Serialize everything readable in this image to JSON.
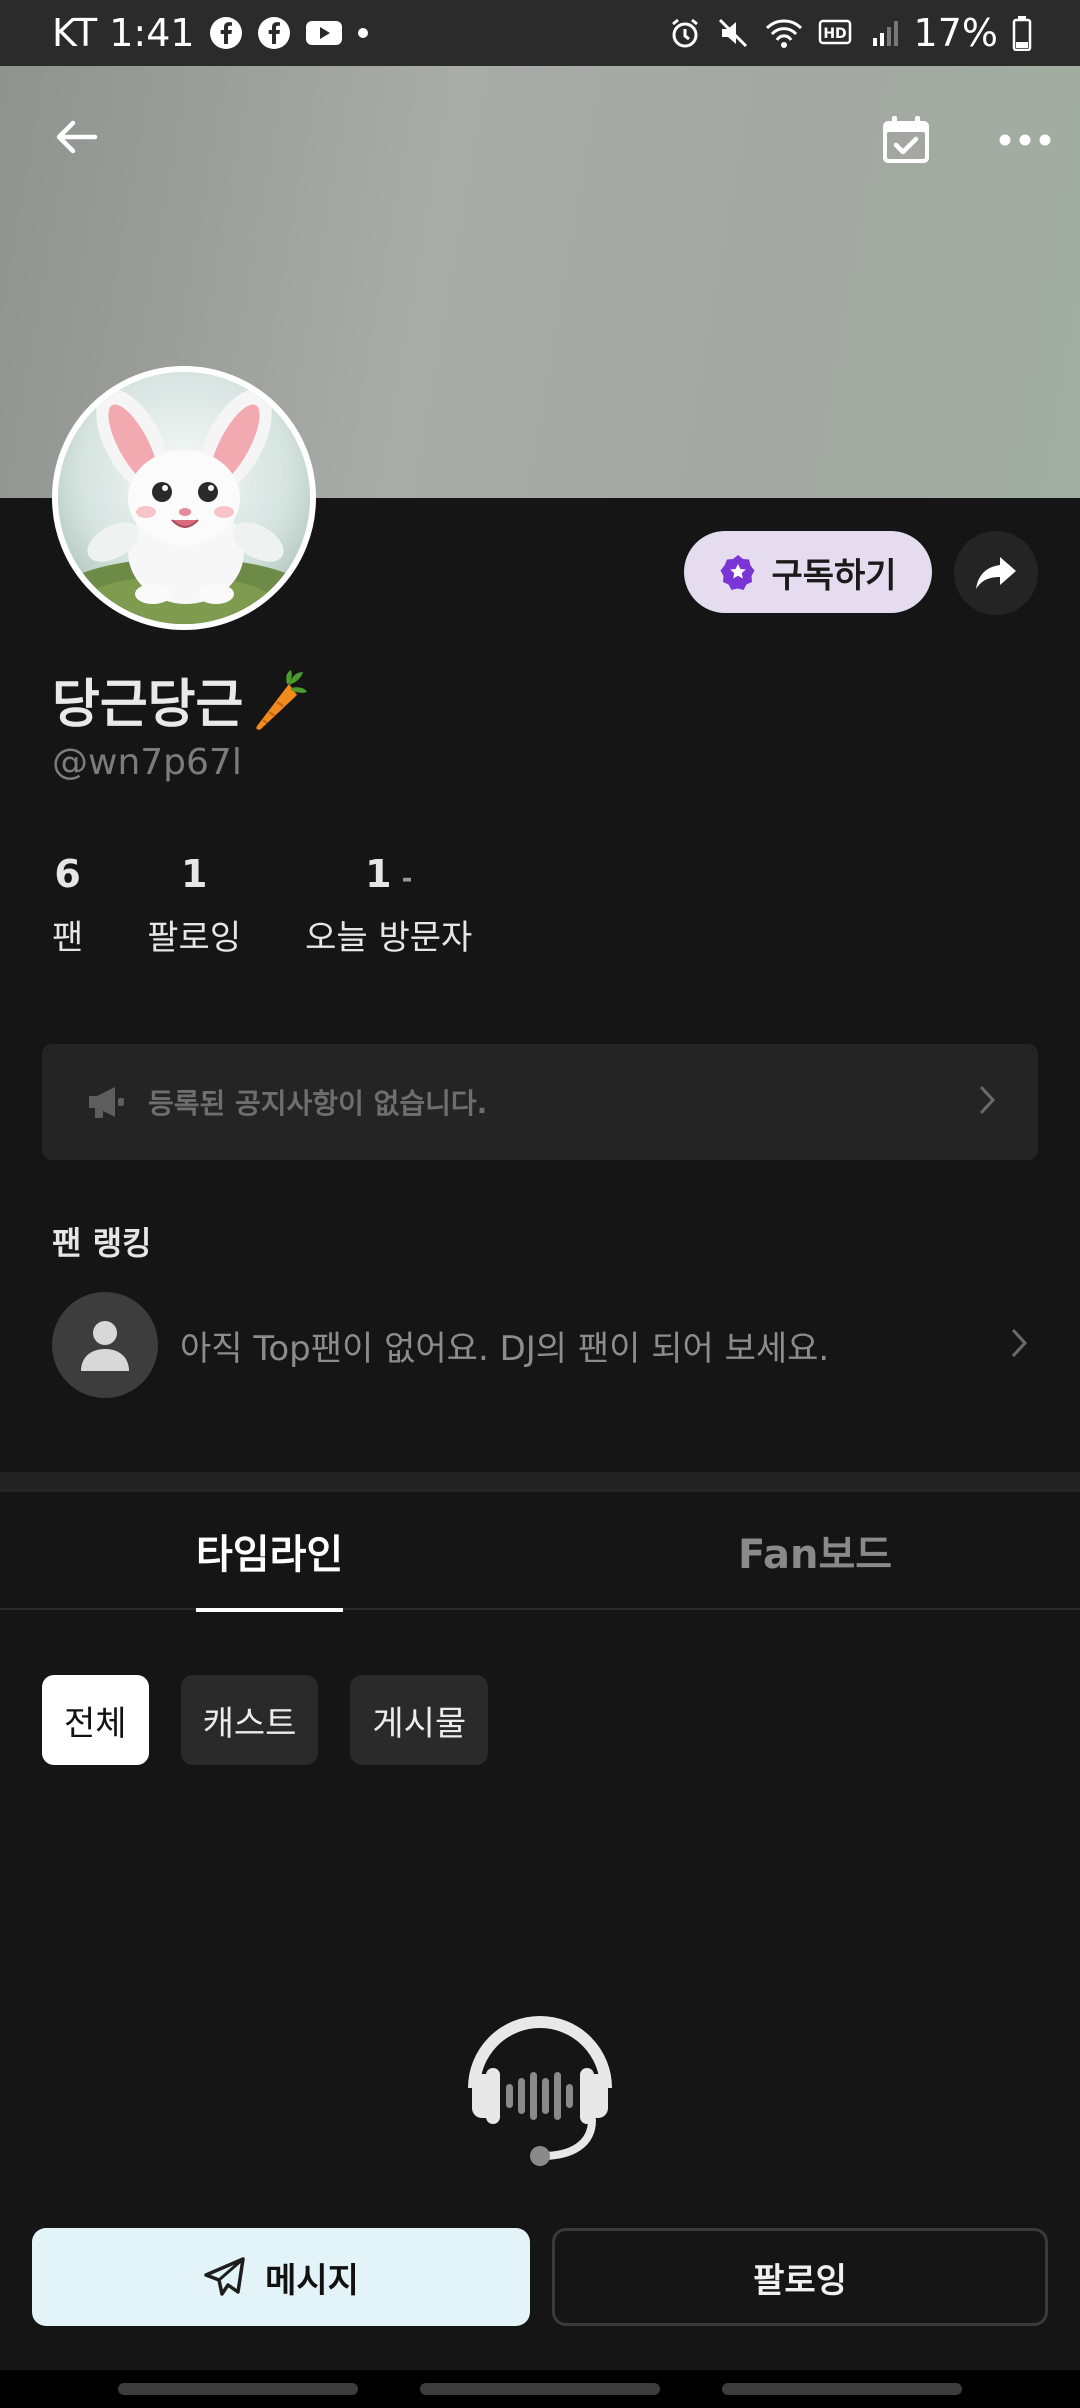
{
  "status_bar": {
    "carrier_time": "KT 1:41",
    "battery": "17%"
  },
  "profile": {
    "name": "당근당근",
    "handle": "@wn7p67l",
    "subscribe_label": "구독하기"
  },
  "stats": [
    {
      "value": "6",
      "label": "팬"
    },
    {
      "value": "1",
      "label": "팔로잉"
    },
    {
      "value": "1",
      "label": "오늘 방문자",
      "suffix": "-"
    }
  ],
  "notice": {
    "text": "등록된 공지사항이 없습니다."
  },
  "fan_ranking": {
    "title": "팬 랭킹",
    "empty_text": "아직 Top팬이 없어요. DJ의 팬이 되어 보세요."
  },
  "tabs": [
    {
      "label": "타임라인",
      "active": true
    },
    {
      "label": "Fan보드",
      "active": false
    }
  ],
  "filters": [
    {
      "label": "전체",
      "selected": true
    },
    {
      "label": "캐스트",
      "selected": false
    },
    {
      "label": "게시물",
      "selected": false
    }
  ],
  "bottom_actions": {
    "message_label": "메시지",
    "follow_label": "팔로잉"
  },
  "colors": {
    "background": "#151515",
    "subscribe_bg": "#e5dcef",
    "subscribe_icon": "#7b35d6",
    "message_bg": "#e3f4f8"
  }
}
